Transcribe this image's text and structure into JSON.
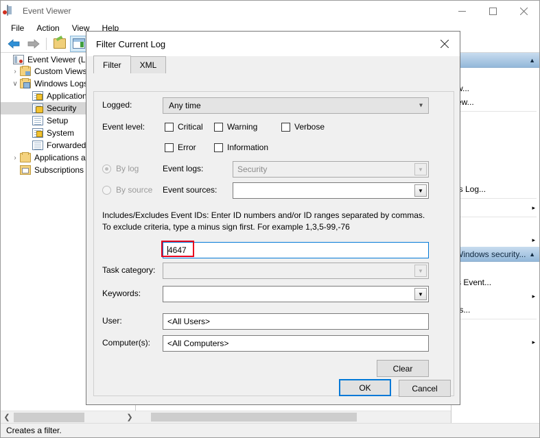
{
  "window": {
    "title": "Event Viewer",
    "icon": "event-viewer-icon",
    "minimize": "—",
    "maximize": "□",
    "close": "✕"
  },
  "menubar": {
    "items": [
      "File",
      "Action",
      "View",
      "Help"
    ]
  },
  "toolbar": {
    "items": [
      "back-arrow-icon",
      "forward-arrow-icon",
      "open-folder-icon",
      "show-hide-pane-icon",
      "properties-icon"
    ]
  },
  "tree": {
    "items": [
      {
        "label": "Event Viewer (Loca",
        "twisty": "",
        "icon": "event-viewer-icon",
        "indent": 0,
        "selected": false
      },
      {
        "label": "Custom Views",
        "twisty": "›",
        "icon": "custom-views-folder-icon",
        "indent": 1,
        "selected": false
      },
      {
        "label": "Windows Logs",
        "twisty": "∨",
        "icon": "windows-logs-folder-icon",
        "indent": 1,
        "selected": false
      },
      {
        "label": "Application",
        "twisty": "",
        "icon": "log-warning-icon",
        "indent": 2,
        "selected": false
      },
      {
        "label": "Security",
        "twisty": "",
        "icon": "log-security-icon",
        "indent": 2,
        "selected": true
      },
      {
        "label": "Setup",
        "twisty": "",
        "icon": "log-icon",
        "indent": 2,
        "selected": false
      },
      {
        "label": "System",
        "twisty": "",
        "icon": "log-warning-icon",
        "indent": 2,
        "selected": false
      },
      {
        "label": "Forwarded",
        "twisty": "",
        "icon": "log-icon",
        "indent": 2,
        "selected": false
      },
      {
        "label": "Applications a",
        "twisty": "›",
        "icon": "folder-icon",
        "indent": 1,
        "selected": false
      },
      {
        "label": "Subscriptions",
        "twisty": "",
        "icon": "subscriptions-icon",
        "indent": 1,
        "selected": false
      }
    ]
  },
  "actions": {
    "section1_title": "",
    "section1_caret": "▲",
    "items1": [
      {
        "label": "w...",
        "submenu": false
      },
      {
        "label": "ew...",
        "submenu": false
      },
      {
        "label": "",
        "submenu": false
      },
      {
        "label": ".",
        "submenu": false
      },
      {
        "label": "",
        "submenu": false
      },
      {
        "label": ".",
        "submenu": false
      },
      {
        "label": "is Log...",
        "submenu": false
      },
      {
        "label": "",
        "submenu": true
      },
      {
        "label": "",
        "submenu": false
      },
      {
        "label": "",
        "submenu": true
      }
    ],
    "section2_title": "Windows security...",
    "section2_caret": "▲",
    "items2": [
      {
        "label": "s Event...",
        "submenu": false
      },
      {
        "label": "",
        "submenu": true
      },
      {
        "label": "ts...",
        "submenu": false
      },
      {
        "label": "",
        "submenu": false
      },
      {
        "label": "",
        "submenu": true
      }
    ]
  },
  "statusbar": {
    "text": "Creates a filter."
  },
  "dialog": {
    "title": "Filter Current Log",
    "close_icon": "✕",
    "tabs": [
      {
        "label": "Filter",
        "active": true
      },
      {
        "label": "XML",
        "active": false
      }
    ],
    "logged": {
      "label": "Logged:",
      "value": "Any time",
      "chevron": "⌄"
    },
    "event_level": {
      "label": "Event level:",
      "checkboxes": [
        {
          "label": "Critical",
          "checked": false
        },
        {
          "label": "Warning",
          "checked": false
        },
        {
          "label": "Verbose",
          "checked": false
        },
        {
          "label": "Error",
          "checked": false
        },
        {
          "label": "Information",
          "checked": false
        }
      ]
    },
    "by_log": {
      "label": "By log",
      "checked": true,
      "disabled": true
    },
    "by_source": {
      "label": "By source",
      "checked": false,
      "disabled": true
    },
    "event_logs": {
      "label": "Event logs:",
      "value": "Security",
      "disabled": true
    },
    "event_sources": {
      "label": "Event sources:",
      "value": "",
      "disabled": false
    },
    "event_ids": {
      "help": "Includes/Excludes Event IDs: Enter ID numbers and/or ID ranges separated by commas. To exclude criteria, type a minus sign first. For example 1,3,5-99,-76",
      "value": "4647",
      "highlighted": true,
      "highlight_color": "#e8001c"
    },
    "task_category": {
      "label": "Task category:",
      "value": "",
      "disabled": true
    },
    "keywords": {
      "label": "Keywords:",
      "value": "",
      "disabled": false
    },
    "user": {
      "label": "User:",
      "value": "<All Users>"
    },
    "computers": {
      "label": "Computer(s):",
      "value": "<All Computers>"
    },
    "clear_button": "Clear",
    "ok_button": "OK",
    "cancel_button": "Cancel"
  }
}
